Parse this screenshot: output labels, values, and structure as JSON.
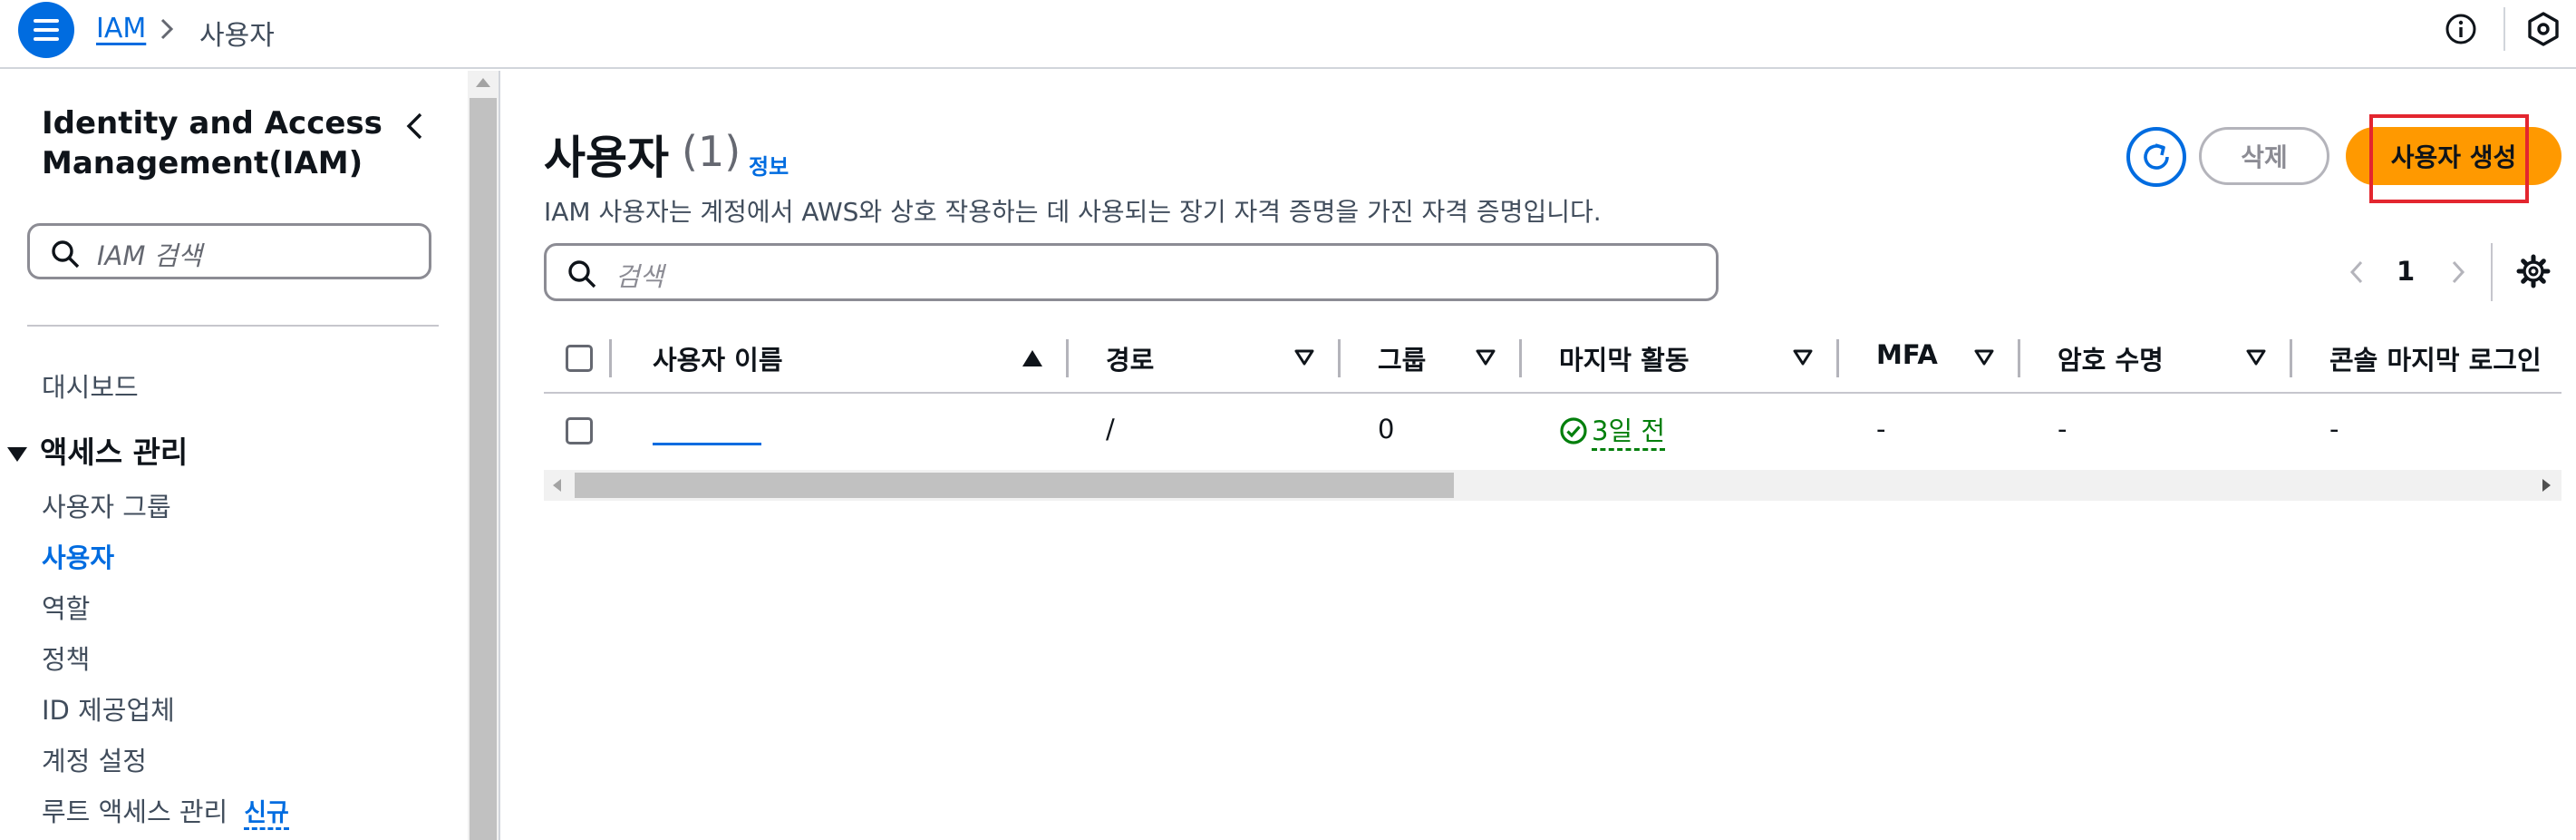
{
  "breadcrumb": {
    "root": "IAM",
    "current": "사용자"
  },
  "topbar_icons": [
    "menu-icon",
    "info-icon",
    "cloudshell-hex-icon"
  ],
  "sidenav": {
    "title": "Identity and Access Management(IAM)",
    "search_placeholder": "IAM 검색",
    "dashboard": "대시보드",
    "section": "액세스 관리",
    "items": [
      {
        "label": "사용자 그룹",
        "active": false
      },
      {
        "label": "사용자",
        "active": true
      },
      {
        "label": "역할",
        "active": false
      },
      {
        "label": "정책",
        "active": false
      },
      {
        "label": "ID 제공업체",
        "active": false
      },
      {
        "label": "계정 설정",
        "active": false
      },
      {
        "label": "루트 액세스 관리",
        "active": false,
        "badge": "신규"
      }
    ]
  },
  "main": {
    "title": "사용자",
    "count": "(1)",
    "info_link": "정보",
    "description": "IAM 사용자는 계정에서 AWS와 상호 작용하는 데 사용되는 장기 자격 증명을 가진 자격 증명입니다.",
    "buttons": {
      "delete": "삭제",
      "create": "사용자 생성"
    },
    "search_placeholder": "검색",
    "pagination": {
      "current_page": "1"
    }
  },
  "table": {
    "columns": [
      "사용자 이름",
      "경로",
      "그룹",
      "마지막 활동",
      "MFA",
      "암호 수명",
      "콘솔 마지막 로그인"
    ],
    "rows": [
      {
        "user_name": "",
        "path": "/",
        "groups": "0",
        "last_activity": "3일 전",
        "mfa": "-",
        "password_age": "-",
        "console_last_login": "-"
      }
    ]
  },
  "colors": {
    "accent": "#006ce0",
    "primary_button": "#ff9900",
    "success": "#037f0c",
    "highlight": "#e3262f"
  }
}
